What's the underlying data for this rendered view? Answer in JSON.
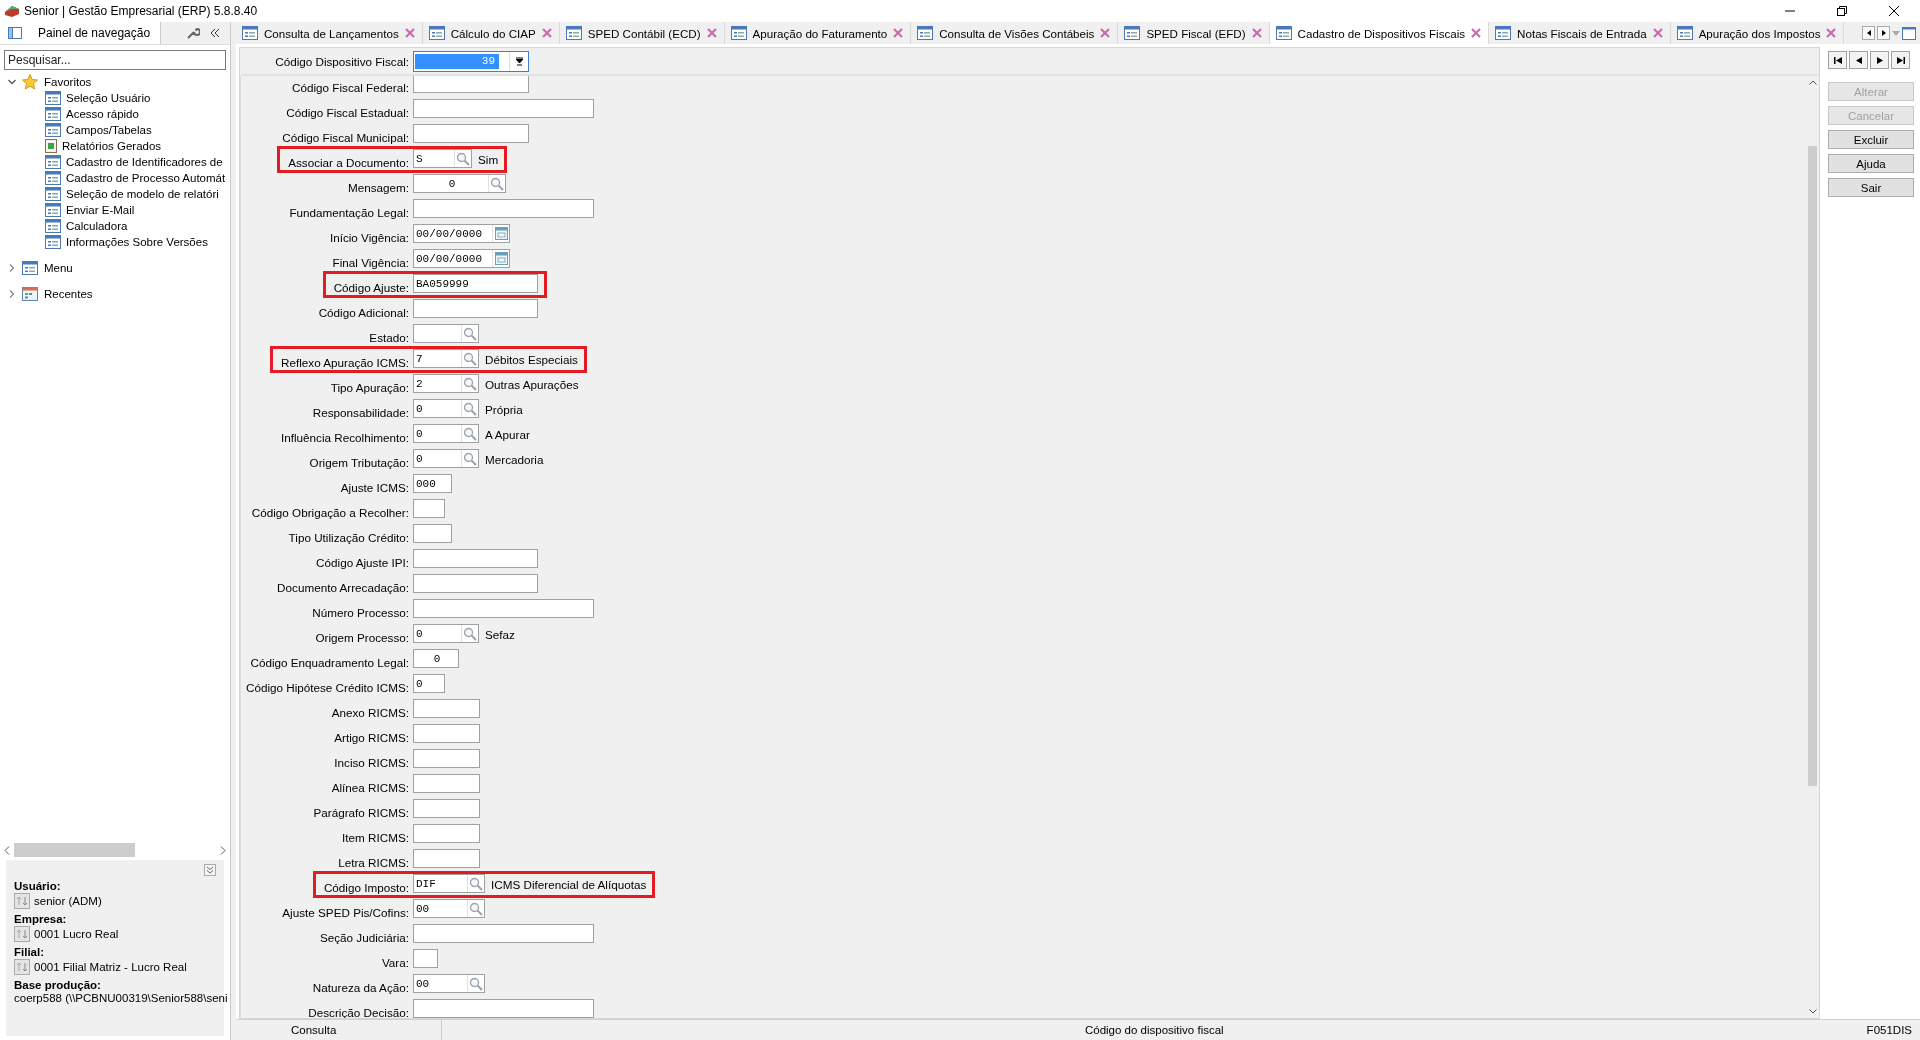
{
  "window": {
    "title": "Senior | Gestão Empresarial (ERP) 5.8.8.40"
  },
  "sidebar": {
    "tab": "Painel de navegação",
    "search": {
      "placeholder": "Pesquisar..."
    },
    "tree": [
      {
        "label": "Favoritos",
        "kind": "star",
        "expanded": true,
        "children": [
          {
            "label": "Seleção Usuário",
            "kind": "form"
          },
          {
            "label": "Acesso rápido",
            "kind": "form"
          },
          {
            "label": "Campos/Tabelas",
            "kind": "form"
          },
          {
            "label": "Relatórios Gerados",
            "kind": "report"
          },
          {
            "label": "Cadastro de Identificadores de",
            "kind": "form"
          },
          {
            "label": "Cadastro de Processo Automát",
            "kind": "form"
          },
          {
            "label": "Seleção de modelo de relatóri",
            "kind": "form"
          },
          {
            "label": "Enviar E-Mail",
            "kind": "form"
          },
          {
            "label": "Calculadora",
            "kind": "form"
          },
          {
            "label": "Informações Sobre Versões",
            "kind": "form"
          }
        ]
      },
      {
        "label": "Menu",
        "kind": "form",
        "expanded": false
      },
      {
        "label": "Recentes",
        "kind": "calendar",
        "expanded": false
      }
    ],
    "info": [
      {
        "label": "Usuário:",
        "value": "senior (ADM)",
        "kind": "switch"
      },
      {
        "label": "Empresa:",
        "value": "0001 Lucro Real",
        "kind": "switch"
      },
      {
        "label": "Filial:",
        "value": "0001 Filial Matriz - Lucro Real",
        "kind": "switch"
      },
      {
        "label": "Base produção:",
        "value": "coerp588 (\\\\PCBNU00319\\Senior588\\seni",
        "kind": "text"
      }
    ]
  },
  "tabs": [
    {
      "label": "Consulta de Lançamentos",
      "selected": false
    },
    {
      "label": "Cálculo do CIAP",
      "selected": false
    },
    {
      "label": "SPED Contábil (ECD)",
      "selected": false
    },
    {
      "label": "Apuração do Faturamento",
      "selected": false
    },
    {
      "label": "Consulta de Visões Contábeis",
      "selected": false
    },
    {
      "label": "SPED Fiscal (EFD)",
      "selected": false
    },
    {
      "label": "Cadastro de Dispositivos Fiscais",
      "selected": true
    },
    {
      "label": "Notas Fiscais de Entrada",
      "selected": false
    },
    {
      "label": "Apuração dos Impostos",
      "selected": false
    }
  ],
  "header": {
    "label": "Código Dispositivo Fiscal:",
    "value": "39"
  },
  "form": {
    "fields": [
      {
        "label": "Código Fiscal Federal:",
        "kind": "text",
        "highlighted": false
      },
      {
        "label": "Código Fiscal Estadual:",
        "kind": "text",
        "highlighted": false
      },
      {
        "label": "Código Fiscal Municipal:",
        "kind": "text",
        "highlighted": false
      },
      {
        "label": "Associar a Documento:",
        "kind": "lookup",
        "value": "S",
        "description": "Sim",
        "highlighted": true
      },
      {
        "label": "Mensagem:",
        "kind": "lookup",
        "value": "0",
        "highlighted": false
      },
      {
        "label": "Fundamentação Legal:",
        "kind": "text",
        "highlighted": false
      },
      {
        "label": "Início Vigência:",
        "kind": "date",
        "value": "00/00/0000",
        "highlighted": false
      },
      {
        "label": "Final Vigência:",
        "kind": "date",
        "value": "00/00/0000",
        "highlighted": false
      },
      {
        "label": "Código Ajuste:",
        "kind": "text",
        "value": "BA059999",
        "highlighted": true
      },
      {
        "label": "Código Adicional:",
        "kind": "text",
        "highlighted": false
      },
      {
        "label": "Estado:",
        "kind": "lookup",
        "highlighted": false
      },
      {
        "label": "Reflexo Apuração ICMS:",
        "kind": "lookup",
        "value": "7",
        "description": "Débitos Especiais",
        "highlighted": true
      },
      {
        "label": "Tipo Apuração:",
        "kind": "lookup",
        "value": "2",
        "description": "Outras Apurações",
        "highlighted": false
      },
      {
        "label": "Responsabilidade:",
        "kind": "lookup",
        "value": "0",
        "description": "Própria",
        "highlighted": false
      },
      {
        "label": "Influência Recolhimento:",
        "kind": "lookup",
        "value": "0",
        "description": "A Apurar",
        "highlighted": false
      },
      {
        "label": "Origem Tributação:",
        "kind": "lookup",
        "value": "0",
        "description": "Mercadoria",
        "highlighted": false
      },
      {
        "label": "Ajuste ICMS:",
        "kind": "text",
        "value": "000",
        "highlighted": false
      },
      {
        "label": "Código Obrigação a Recolher:",
        "kind": "text",
        "highlighted": false
      },
      {
        "label": "Tipo Utilização Crédito:",
        "kind": "text",
        "highlighted": false
      },
      {
        "label": "Código Ajuste IPI:",
        "kind": "text",
        "highlighted": false
      },
      {
        "label": "Documento Arrecadação:",
        "kind": "text",
        "highlighted": false
      },
      {
        "label": "Número Processo:",
        "kind": "text",
        "highlighted": false
      },
      {
        "label": "Origem Processo:",
        "kind": "lookup",
        "value": "0",
        "description": "Sefaz",
        "highlighted": false
      },
      {
        "label": "Código Enquadramento Legal:",
        "kind": "text",
        "value": "0",
        "highlighted": false
      },
      {
        "label": "Código Hipótese Crédito ICMS:",
        "kind": "text",
        "value": "0",
        "highlighted": false
      },
      {
        "label": "Anexo RICMS:",
        "kind": "text",
        "highlighted": false
      },
      {
        "label": "Artigo RICMS:",
        "kind": "text",
        "highlighted": false
      },
      {
        "label": "Inciso RICMS:",
        "kind": "text",
        "highlighted": false
      },
      {
        "label": "Alínea RICMS:",
        "kind": "text",
        "highlighted": false
      },
      {
        "label": "Parágrafo RICMS:",
        "kind": "text",
        "highlighted": false
      },
      {
        "label": "Item RICMS:",
        "kind": "text",
        "highlighted": false
      },
      {
        "label": "Letra RICMS:",
        "kind": "text",
        "highlighted": false
      },
      {
        "label": "Código Imposto:",
        "kind": "lookup",
        "value": "DIF",
        "description": "ICMS Diferencial de Alíquotas",
        "highlighted": true
      },
      {
        "label": "Ajuste SPED Pis/Cofins:",
        "kind": "lookup",
        "value": "00",
        "highlighted": false
      },
      {
        "label": "Seção Judiciária:",
        "kind": "text",
        "highlighted": false
      },
      {
        "label": "Vara:",
        "kind": "text",
        "highlighted": false
      },
      {
        "label": "Natureza da Ação:",
        "kind": "lookup",
        "value": "00",
        "highlighted": false
      },
      {
        "label": "Descrição Decisão:",
        "kind": "text",
        "highlighted": false
      }
    ]
  },
  "actions": [
    {
      "label": "Alterar",
      "disabled": true
    },
    {
      "label": "Cancelar",
      "disabled": true
    },
    {
      "label": "Excluir",
      "disabled": false
    },
    {
      "label": "Ajuda",
      "disabled": false
    },
    {
      "label": "Sair",
      "disabled": false
    }
  ],
  "status_bar": {
    "mode": "Consulta",
    "hint": "Código do dispositivo fiscal",
    "code": "F051DIS"
  }
}
